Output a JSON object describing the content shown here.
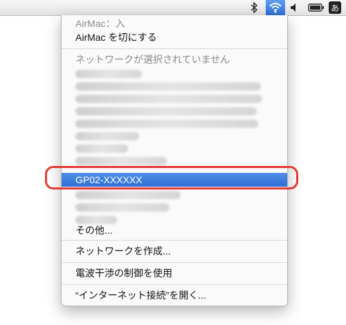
{
  "menubar": {
    "icons": [
      "bluetooth-icon",
      "wifi-icon",
      "volume-icon",
      "battery-icon",
      "input-method-icon"
    ],
    "ime_label": "あ",
    "accent": "#2f6fd5"
  },
  "menu": {
    "status": "AirMac：入",
    "toggle_off": "AirMac を切にする",
    "no_network": "ネットワークが選択されていません",
    "selected_network": "GP02-XXXXXX",
    "other": "その他...",
    "create_network": "ネットワークを作成...",
    "interference": "電波干渉の制御を使用",
    "open_connect": "“インターネット接続”を開く..."
  },
  "annotation": {
    "ring_color": "#e53935"
  }
}
